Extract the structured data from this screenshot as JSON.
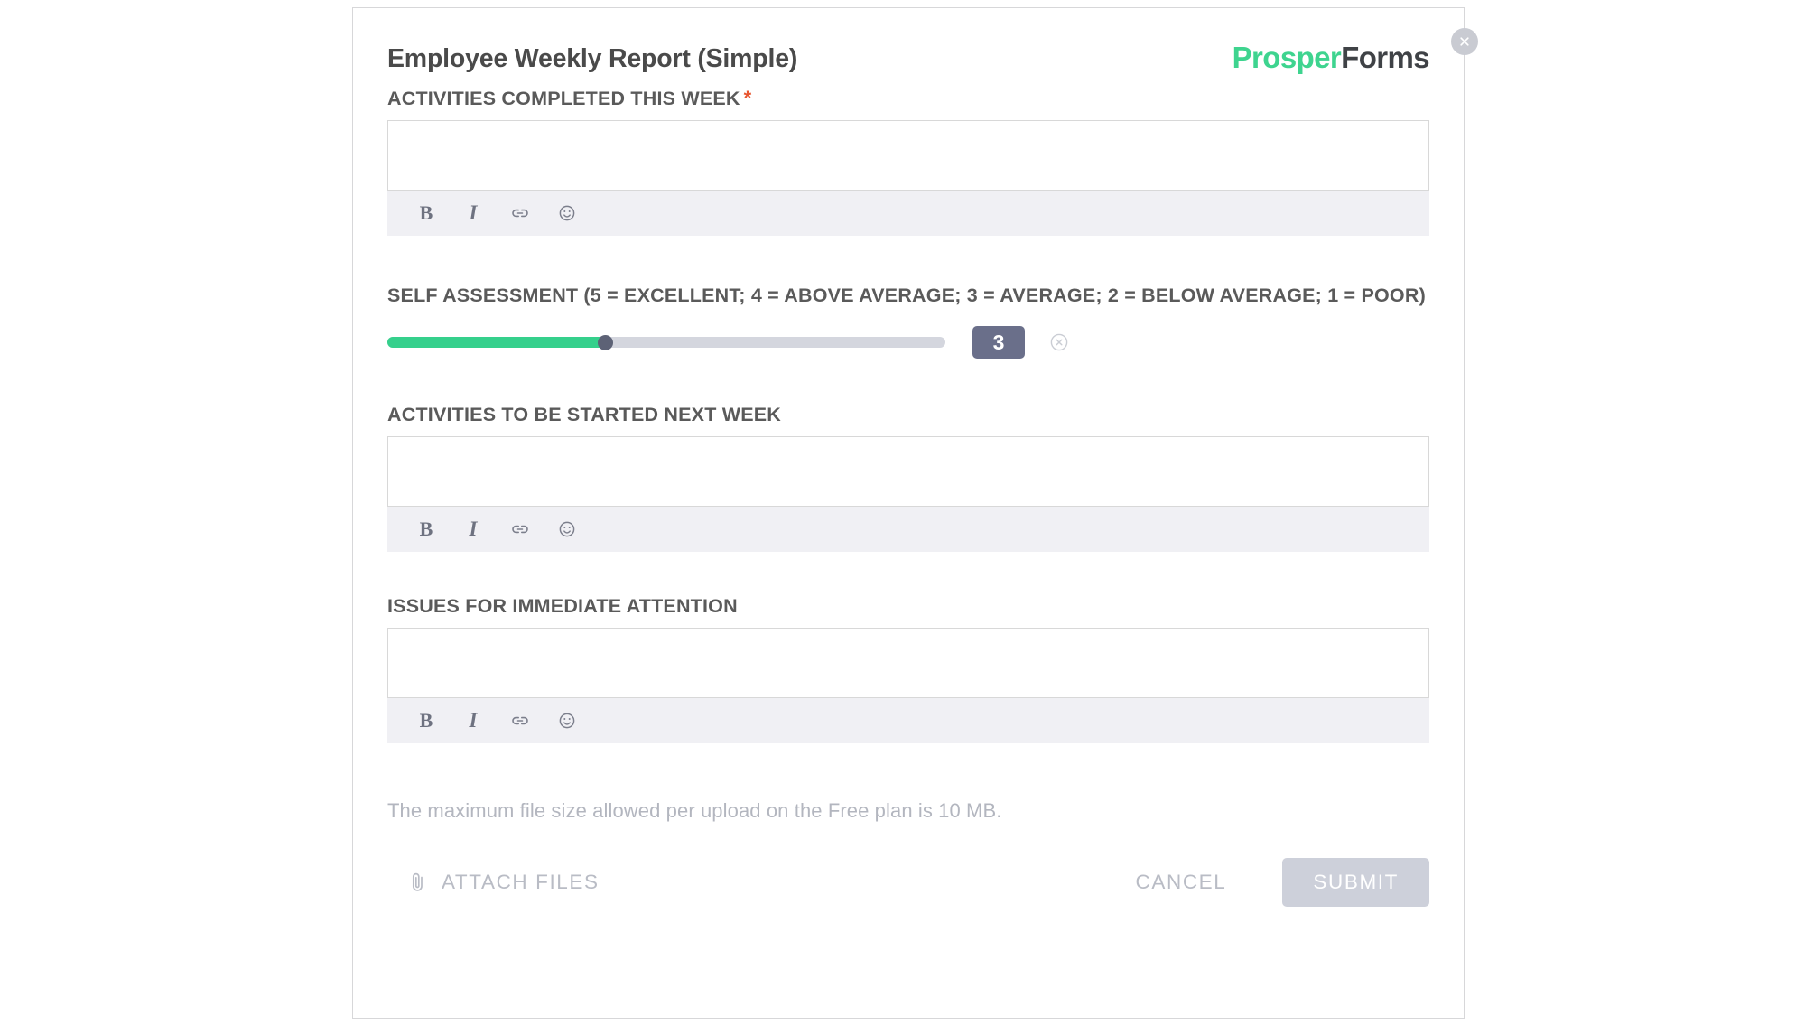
{
  "dialog": {
    "title": "Employee Weekly Report (Simple)",
    "close_icon": "close-circle-icon",
    "brand": {
      "first": "Prosper",
      "second": "Forms"
    }
  },
  "fields": [
    {
      "label": "ACTIVITIES COMPLETED THIS WEEK",
      "required": true,
      "required_marker": "*",
      "value": "",
      "type": "richtext"
    },
    {
      "label": "SELF ASSESSMENT (5 = EXCELLENT; 4 = ABOVE AVERAGE; 3 = AVERAGE; 2 = BELOW AVERAGE; 1 = POOR)",
      "required": false,
      "type": "slider",
      "value": "3",
      "min": 1,
      "max": 5,
      "fill_percent": 39,
      "clear_icon": "clear-circle-icon"
    },
    {
      "label": "ACTIVITIES TO BE STARTED NEXT WEEK",
      "required": false,
      "value": "",
      "type": "richtext"
    },
    {
      "label": "ISSUES FOR IMMEDIATE ATTENTION",
      "required": false,
      "value": "",
      "type": "richtext"
    }
  ],
  "toolbar": {
    "bold_label": "B",
    "italic_label": "I",
    "link_icon": "link-icon",
    "emoji_icon": "emoji-smiley-icon"
  },
  "footer": {
    "file_note": "The maximum file size allowed per upload on the Free plan is 10 MB.",
    "attach_label": "ATTACH FILES",
    "attach_icon": "paperclip-icon",
    "cancel_label": "CANCEL",
    "submit_label": "SUBMIT",
    "submit_disabled": true
  },
  "colors": {
    "accent_green": "#35d08c",
    "brand_dark": "#3f4246",
    "required_orange": "#e8552f",
    "badge_slate": "#6a6f8a",
    "toolbar_bg": "#f0f0f4",
    "submit_disabled_bg": "#cdd0da"
  }
}
